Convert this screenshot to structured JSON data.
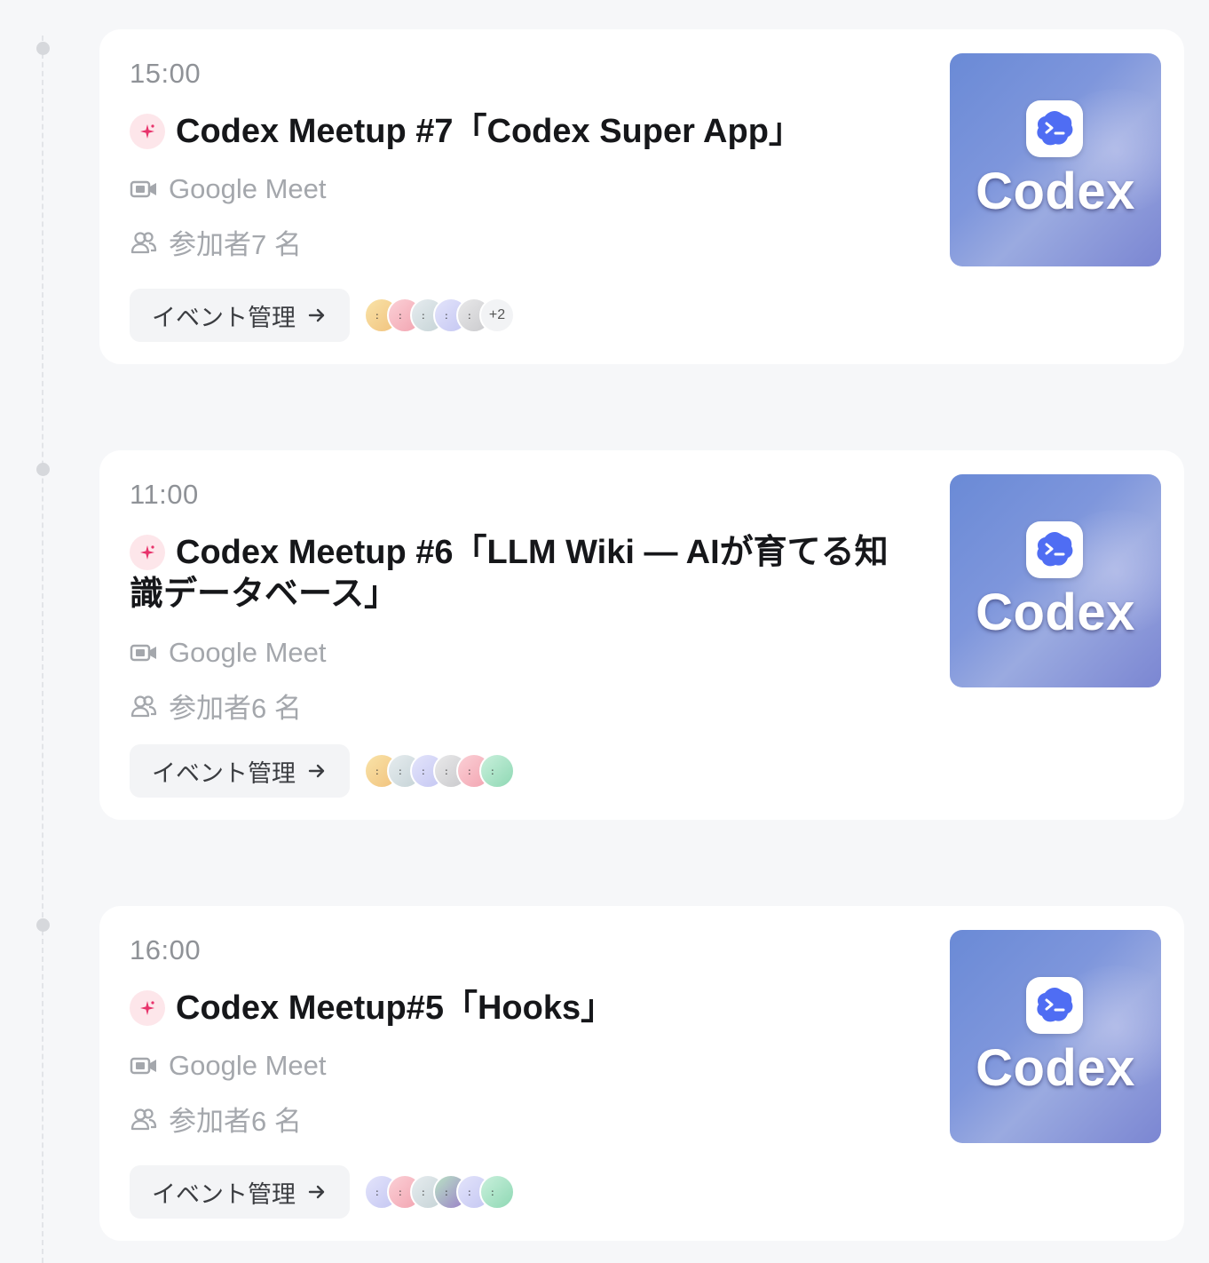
{
  "events": [
    {
      "time": "15:00",
      "title": "Codex Meetup #7「Codex Super App」",
      "location": "Google Meet",
      "attendees": "参加者7 名",
      "manage_label": "イベント管理",
      "avatar_overflow": "+2",
      "thumbnail_text": "Codex"
    },
    {
      "time": "11:00",
      "title": "Codex Meetup #6「LLM Wiki — AIが育てる知識データベース」",
      "location": "Google Meet",
      "attendees": "参加者6 名",
      "manage_label": "イベント管理",
      "thumbnail_text": "Codex"
    },
    {
      "time": "16:00",
      "title": "Codex Meetup#5「Hooks」",
      "location": "Google Meet",
      "attendees": "参加者6 名",
      "manage_label": "イベント管理",
      "thumbnail_text": "Codex"
    }
  ],
  "colors": {
    "background": "#f6f7f9",
    "card": "#ffffff",
    "badge_bg": "#fde6ea",
    "badge_icon": "#e8336b",
    "thumbnail_blue": "#6a8ad6"
  },
  "icons": {
    "title_badge": "sparkle-icon",
    "location": "video-camera-icon",
    "attendees": "people-icon",
    "manage_arrow": "arrow-right-icon",
    "thumbnail": "codex-logo-icon"
  }
}
